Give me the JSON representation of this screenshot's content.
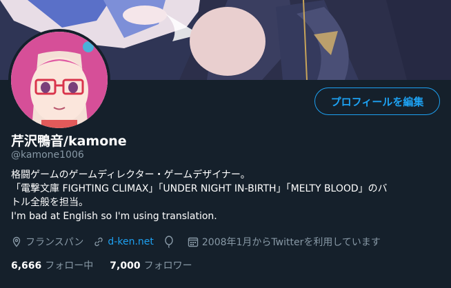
{
  "profile": {
    "display_name": "芹沢鴨音/kamone",
    "handle": "@kamone1006",
    "bio_lines": [
      "格闘ゲームのゲームディレクター・ゲームデザイナー。",
      "「電撃文庫 FIGHTING CLIMAX」「UNDER NIGHT IN-BIRTH」「MELTY BLOOD」のバ",
      "トル全般を担当。",
      "I'm bad at English so I'm using translation."
    ],
    "location": "フランスパン",
    "website": "d-ken.net",
    "joined": "2008年1月からTwitterを利用しています"
  },
  "actions": {
    "edit_profile": "プロフィールを編集"
  },
  "stats": {
    "following_count": "6,666",
    "following_label": "フォロー中",
    "followers_count": "7,000",
    "followers_label": "フォロワー"
  },
  "colors": {
    "background": "#15202b",
    "accent": "#1da1f2",
    "muted_text": "#8899a6",
    "primary_text": "#ffffff"
  },
  "icons": [
    "location-icon",
    "link-icon",
    "birthday-balloon-icon",
    "calendar-icon"
  ]
}
